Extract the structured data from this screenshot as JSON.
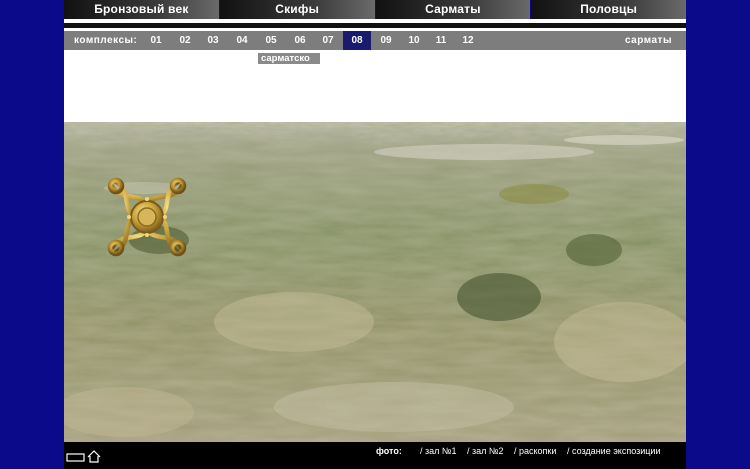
{
  "nav": {
    "tabs": [
      "Бронзовый век",
      "Скифы",
      "Сарматы",
      "Половцы"
    ]
  },
  "complexes": {
    "label": "комплексы:",
    "numbers": [
      "01",
      "02",
      "03",
      "04",
      "05",
      "06",
      "07",
      "08",
      "09",
      "10",
      "11",
      "12"
    ],
    "active": "08",
    "right_label": "сарматы"
  },
  "tooltip": "сарматско",
  "footer": {
    "photo_label": "фото:",
    "links": [
      "/ зал №1",
      "/ зал №2",
      "/ раскопки",
      "/ создание экспозиции"
    ]
  },
  "icons": [
    "window-icon",
    "home-icon"
  ],
  "colors": {
    "background": "#0a0a8a",
    "active_number": "#1a1a6e",
    "bar": "#7d7d7d"
  }
}
